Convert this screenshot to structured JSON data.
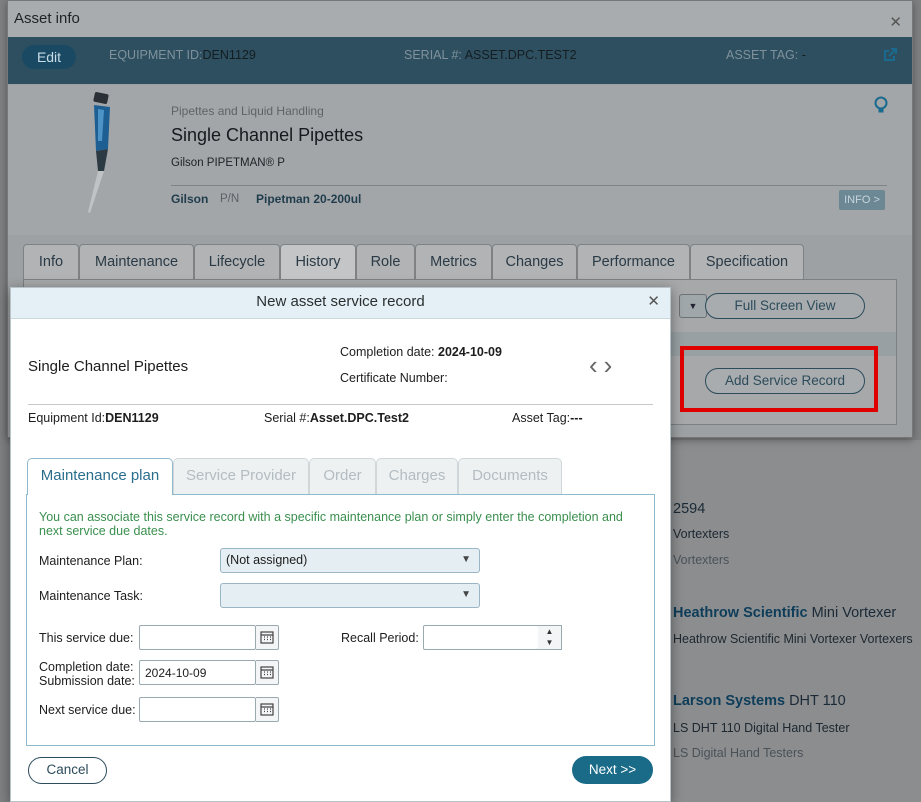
{
  "background_list": [
    {
      "title": "2594",
      "line1": "Vortexters",
      "line2": "Vortexters"
    },
    {
      "brand": "Heathrow Scientific",
      "model": "Mini Vortexer",
      "line1": "Heathrow Scientific Mini Vortexer Vortexers"
    },
    {
      "brand": "Larson Systems",
      "model": "DHT 110",
      "line1": "LS DHT 110 Digital Hand Tester",
      "line2": "LS Digital Hand Testers"
    }
  ],
  "asset_window": {
    "title": "Asset info",
    "edit_label": "Edit",
    "equipment_id_label": "EQUIPMENT ID:",
    "equipment_id": "DEN1129",
    "serial_label": "SERIAL #:",
    "serial": "ASSET.DPC.TEST2",
    "asset_tag_label": "ASSET TAG:",
    "asset_tag": "-",
    "category": "Pipettes and Liquid Handling",
    "product_name": "Single Channel Pipettes",
    "brand_model": "Gilson PIPETMAN® P",
    "manufacturer": "Gilson",
    "pn_label": "P/N",
    "pn_value": "Pipetman 20-200ul",
    "info_button": "INFO >",
    "tabs": [
      "Info",
      "Maintenance",
      "Lifecycle",
      "History",
      "Role",
      "Metrics",
      "Changes",
      "Performance",
      "Specification"
    ],
    "active_tab": "History",
    "full_screen_button": "Full Screen View",
    "add_service_record_button": "Add Service Record"
  },
  "modal": {
    "title": "New asset service record",
    "product_name": "Single Channel Pipettes",
    "completion_date_label": "Completion date:",
    "completion_date": "2024-10-09",
    "certificate_label": "Certificate Number:",
    "equipment_id_label": "Equipment Id:",
    "equipment_id": "DEN1129",
    "serial_label": "Serial #:",
    "serial": "Asset.DPC.Test2",
    "asset_tag_label": "Asset Tag:",
    "asset_tag": "---",
    "tabs": [
      "Maintenance plan",
      "Service Provider",
      "Order",
      "Charges",
      "Documents"
    ],
    "active_tab": "Maintenance plan",
    "hint": "You can associate this service record with a specific maintenance plan or simply enter the completion and next service due dates.",
    "maintenance_plan_label": "Maintenance Plan:",
    "maintenance_plan_value": "(Not assigned)",
    "maintenance_task_label": "Maintenance Task:",
    "maintenance_task_value": "",
    "this_service_due_label": "This service due:",
    "this_service_due_value": "",
    "recall_period_label": "Recall Period:",
    "recall_period_value": "",
    "completion_date_field_label": "Completion date:",
    "submission_date_label": "Submission date:",
    "completion_date_field_value": "2024-10-09",
    "next_service_due_label": "Next service due:",
    "next_service_due_value": "",
    "cancel_label": "Cancel",
    "next_label": "Next >>"
  },
  "colors": {
    "accent": "#1a6b88",
    "hint_green": "#3a8f4e",
    "highlight_red": "#e00000"
  }
}
